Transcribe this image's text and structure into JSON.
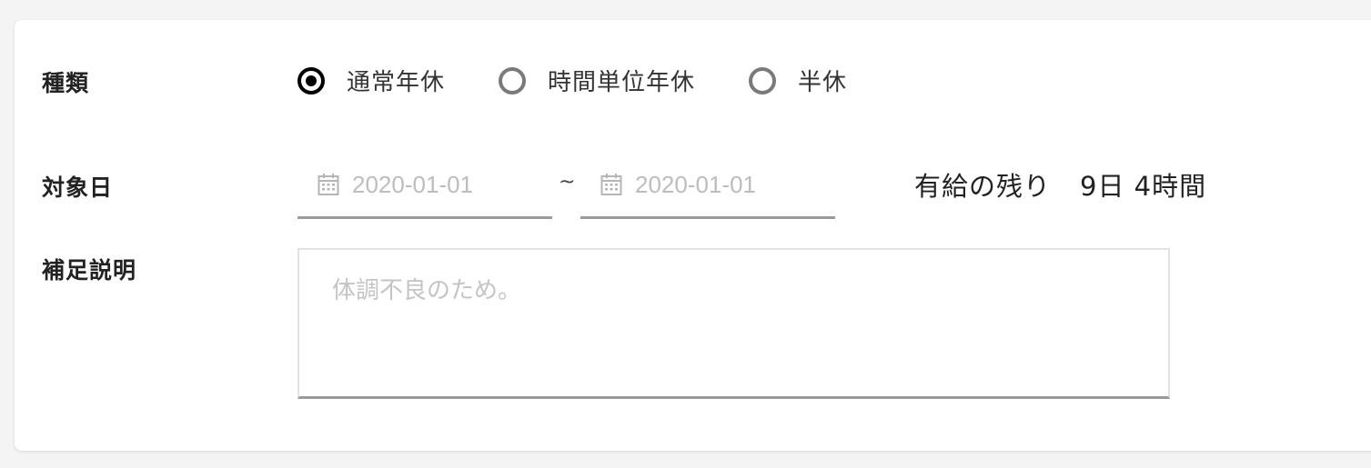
{
  "form": {
    "type_label": "種類",
    "type_options": [
      {
        "label": "通常年休",
        "selected": true
      },
      {
        "label": "時間単位年休",
        "selected": false
      },
      {
        "label": "半休",
        "selected": false
      }
    ],
    "date_label": "対象日",
    "date_from": {
      "placeholder": "2020-01-01",
      "icon": "calendar-icon"
    },
    "date_separator": "~",
    "date_to": {
      "placeholder": "2020-01-01",
      "icon": "calendar-icon"
    },
    "remaining_label": "有給の残り",
    "remaining_value": "9日 4時間",
    "note_label": "補足説明",
    "note_placeholder": "体調不良のため。"
  },
  "colors": {
    "selected_radio": "#000000",
    "unselected_radio": "#7a7a7a",
    "underline": "#9a9a9a",
    "placeholder": "#bdbdbd"
  }
}
